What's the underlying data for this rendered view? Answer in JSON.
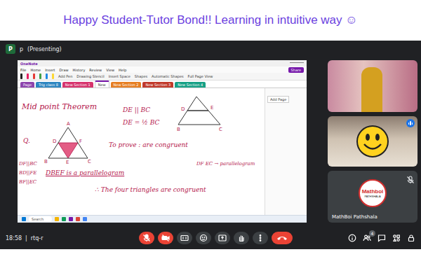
{
  "banner": {
    "text": "Happy Student-Tutor Bond!! Learning  in intuitive way ☺"
  },
  "meet": {
    "presenter": {
      "avatar": "P",
      "name": "p",
      "status": "(Presenting)"
    },
    "time": "18:58",
    "separator": "|",
    "meeting_code": "rtq-r",
    "controls": [
      {
        "kind": "mic",
        "off": true
      },
      {
        "kind": "camera",
        "off": true
      },
      {
        "kind": "captions",
        "off": false
      },
      {
        "kind": "emoji",
        "off": false
      },
      {
        "kind": "present",
        "off": false
      },
      {
        "kind": "hand",
        "off": false
      },
      {
        "kind": "more",
        "off": false
      },
      {
        "kind": "end",
        "off": true
      }
    ],
    "side_controls": [
      {
        "kind": "info",
        "badge": ""
      },
      {
        "kind": "people",
        "badge": "4"
      },
      {
        "kind": "chat",
        "badge": ""
      },
      {
        "kind": "activities",
        "badge": ""
      },
      {
        "kind": "lock",
        "badge": ""
      }
    ]
  },
  "tiles": [
    {
      "kind": "video",
      "speaking": false,
      "muted": false,
      "logo": "",
      "logo_sub": "",
      "name": ""
    },
    {
      "kind": "avatar",
      "speaking": true,
      "muted": false,
      "logo": "",
      "logo_sub": "",
      "name": ""
    },
    {
      "kind": "logo",
      "speaking": false,
      "muted": true,
      "logo": "Mathboi",
      "logo_sub": "PATHSHALA",
      "name": "MathBoi Pathshala"
    }
  ],
  "onenote": {
    "app": "OneNote",
    "menu": [
      "File",
      "Home",
      "Insert",
      "Draw",
      "History",
      "Review",
      "View",
      "Help"
    ],
    "share": "Share",
    "ribbon": [
      "Add Pen",
      "Drawing Stencil",
      "Insert Space",
      "Shapes",
      "Automatic Shapes",
      "Full Page View"
    ],
    "sections": [
      {
        "label": "Page",
        "selected": false,
        "color": "#8e44ad"
      },
      {
        "label": "Trig class 8",
        "selected": false,
        "color": "#2e86c1"
      },
      {
        "label": "New Section 1",
        "selected": false,
        "color": "#d6336c"
      },
      {
        "label": "New",
        "selected": true,
        "color": "#7719aa"
      },
      {
        "label": "New Section 2",
        "selected": false,
        "color": "#e67e22"
      },
      {
        "label": "New Section 3",
        "selected": false,
        "color": "#c0392b"
      },
      {
        "label": "New Section 4",
        "selected": false,
        "color": "#16a085"
      }
    ],
    "add_page": "Add Page",
    "notes": {
      "heading": "Mid point Theorem",
      "given_1": "DE || BC",
      "given_2": "DE = ½ BC",
      "question": "Q.",
      "to_prove": "To prove : are congruent",
      "left_1": "DF||BC",
      "left_2": "BD||FE",
      "left_3": "BF||EC",
      "claim": "DBEF is a parallelogram",
      "side_note": "DF EC → parallelogram",
      "conclusion": "∴ The four triangles are congruent"
    },
    "small_triangle": [
      "D",
      "E",
      "B",
      "C"
    ],
    "main_triangle": [
      "A",
      "D",
      "F",
      "B",
      "E",
      "C"
    ],
    "taskbar": {
      "search": "Search"
    }
  }
}
